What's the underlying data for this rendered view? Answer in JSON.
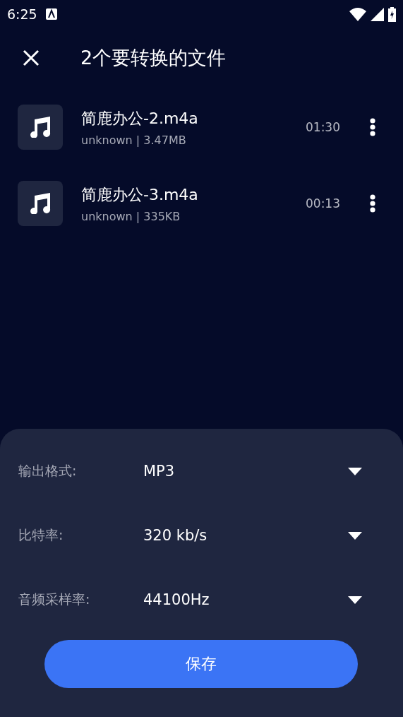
{
  "status_bar": {
    "time": "6:25"
  },
  "header": {
    "title": "2个要转换的文件"
  },
  "files": [
    {
      "name": "简鹿办公-2.m4a",
      "meta": "unknown | 3.47MB",
      "duration": "01:30"
    },
    {
      "name": "简鹿办公-3.m4a",
      "meta": "unknown | 335KB",
      "duration": "00:13"
    }
  ],
  "settings": [
    {
      "label": "输出格式:",
      "value": "MP3"
    },
    {
      "label": "比特率:",
      "value": "320 kb/s"
    },
    {
      "label": "音频采样率:",
      "value": "44100Hz"
    }
  ],
  "save_button": "保存"
}
